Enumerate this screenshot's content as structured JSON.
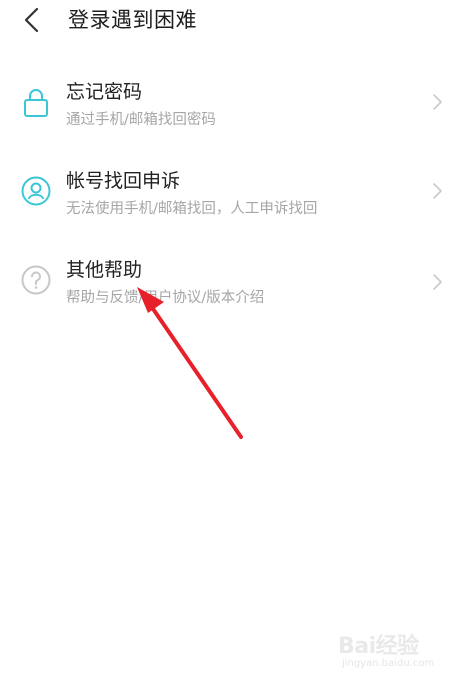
{
  "header": {
    "back_icon": "chevron-left-icon",
    "title": "登录遇到困难"
  },
  "items": [
    {
      "icon": "lock-icon",
      "title": "忘记密码",
      "description": "通过手机/邮箱找回密码"
    },
    {
      "icon": "user-circle-icon",
      "title": "帐号找回申诉",
      "description": "无法使用手机/邮箱找回，人工申诉找回"
    },
    {
      "icon": "question-circle-icon",
      "title": "其他帮助",
      "description": "帮助与反馈/用户协议/版本介绍"
    }
  ],
  "watermark": {
    "logo": "Bai经验",
    "url": "jingyan.baidu.com"
  },
  "colors": {
    "accent": "#3bc6d6",
    "muted_icon": "#c7c7c7",
    "chevron": "#c9c9c9",
    "annotation_arrow": "#e8202a"
  }
}
